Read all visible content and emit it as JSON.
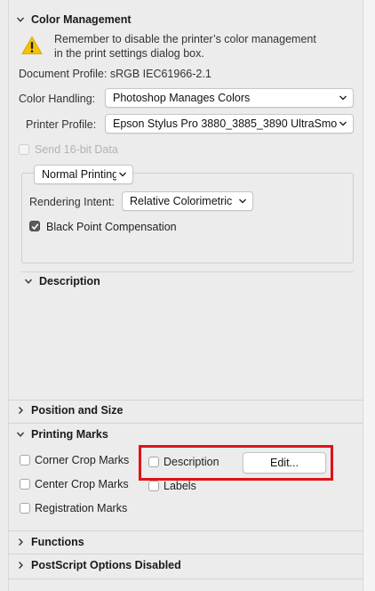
{
  "color_management": {
    "title": "Color Management",
    "warning_text": "Remember to disable the printer’s color management in the print settings dialog box.",
    "document_profile": "Document Profile: sRGB IEC61966-2.1",
    "color_handling_label": "Color Handling:",
    "color_handling_value": "Photoshop Manages Colors",
    "printer_profile_label": "Printer Profile:",
    "printer_profile_value": "Epson Stylus Pro 3880_3885_3890 UltraSmo...",
    "send_16bit_label": "Send 16-bit Data",
    "send_16bit_checked": false,
    "send_16bit_enabled": false,
    "printing_mode_value": "Normal Printing",
    "rendering_intent_label": "Rendering Intent:",
    "rendering_intent_value": "Relative Colorimetric",
    "black_point_label": "Black Point Compensation",
    "black_point_checked": true,
    "description_title": "Description"
  },
  "position_and_size": {
    "title": "Position and Size"
  },
  "printing_marks": {
    "title": "Printing Marks",
    "corner_crop_label": "Corner Crop Marks",
    "center_crop_label": "Center Crop Marks",
    "registration_label": "Registration Marks",
    "description_label": "Description",
    "labels_label": "Labels",
    "edit_label": "Edit..."
  },
  "functions": {
    "title": "Functions"
  },
  "postscript": {
    "title": "PostScript Options Disabled"
  },
  "colors": {
    "highlight": "#e0121a",
    "warning_yellow": "#f5c400",
    "panel_bg": "#ececec"
  },
  "icons": [
    "chevron-down-icon",
    "chevron-right-icon",
    "warning-icon",
    "select-arrows-icon",
    "checkmark-icon"
  ]
}
